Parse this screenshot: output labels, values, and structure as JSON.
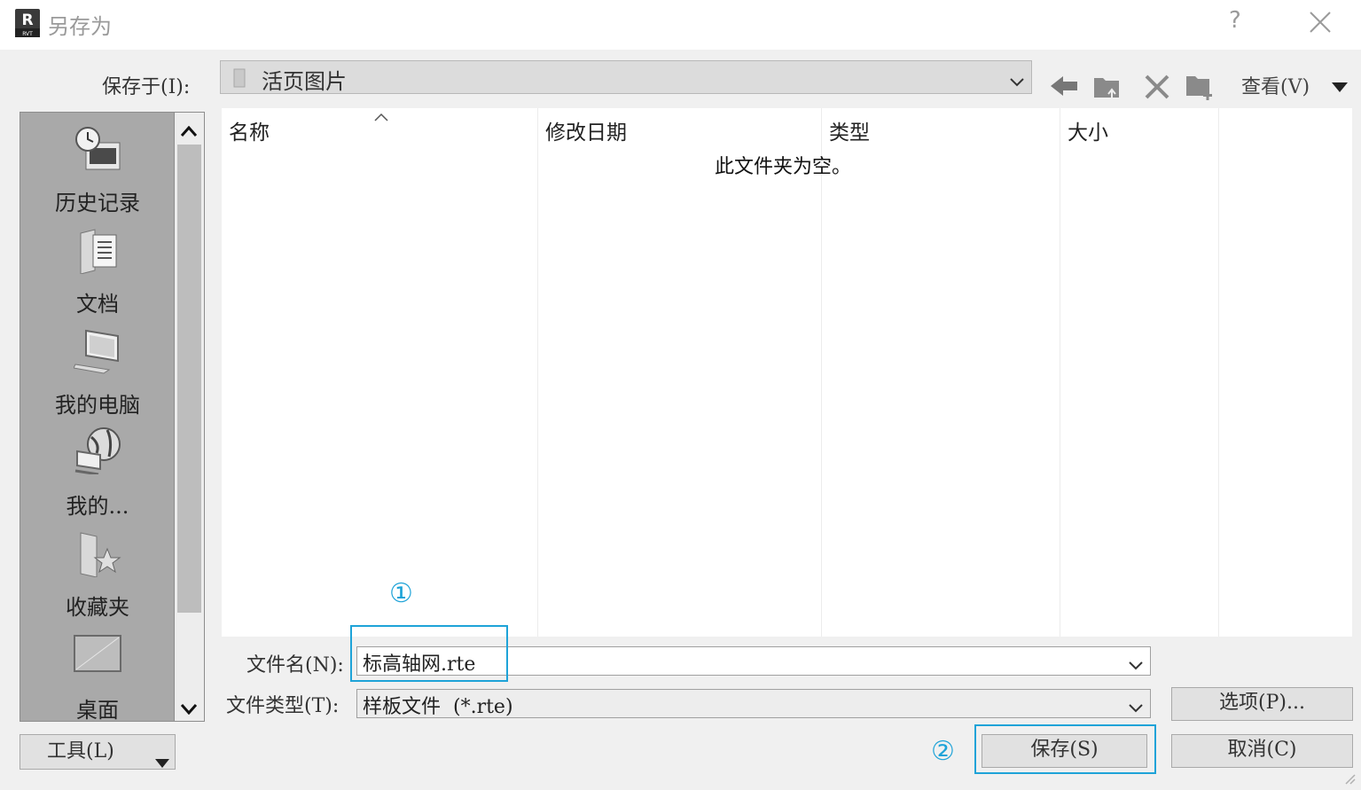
{
  "window": {
    "title": "另存为",
    "app_icon_letter": "R",
    "app_icon_sub": "RVT",
    "help": "?"
  },
  "save_in": {
    "label": "保存于(I):",
    "value": "活页图片"
  },
  "toolbar": {
    "view_label": "查看(V)"
  },
  "places": [
    {
      "label": "历史记录",
      "icon": "history-icon"
    },
    {
      "label": "文档",
      "icon": "documents-icon"
    },
    {
      "label": "我的电脑",
      "icon": "computer-icon"
    },
    {
      "label": "我的...",
      "icon": "network-icon"
    },
    {
      "label": "收藏夹",
      "icon": "favorites-icon"
    },
    {
      "label": "桌面",
      "icon": "desktop-icon"
    }
  ],
  "file_list": {
    "columns": [
      "名称",
      "修改日期",
      "类型",
      "大小"
    ],
    "empty_message": "此文件夹为空。"
  },
  "filename": {
    "label": "文件名(N):",
    "value": "标高轴网.rte"
  },
  "filetype": {
    "label": "文件类型(T):",
    "value": "样板文件  (*.rte)"
  },
  "buttons": {
    "tools": "工具(L)",
    "options": "选项(P)...",
    "save": "保存(S)",
    "cancel": "取消(C)"
  },
  "annotations": {
    "step1": "①",
    "step2": "②",
    "color": "#1ea3d8"
  }
}
